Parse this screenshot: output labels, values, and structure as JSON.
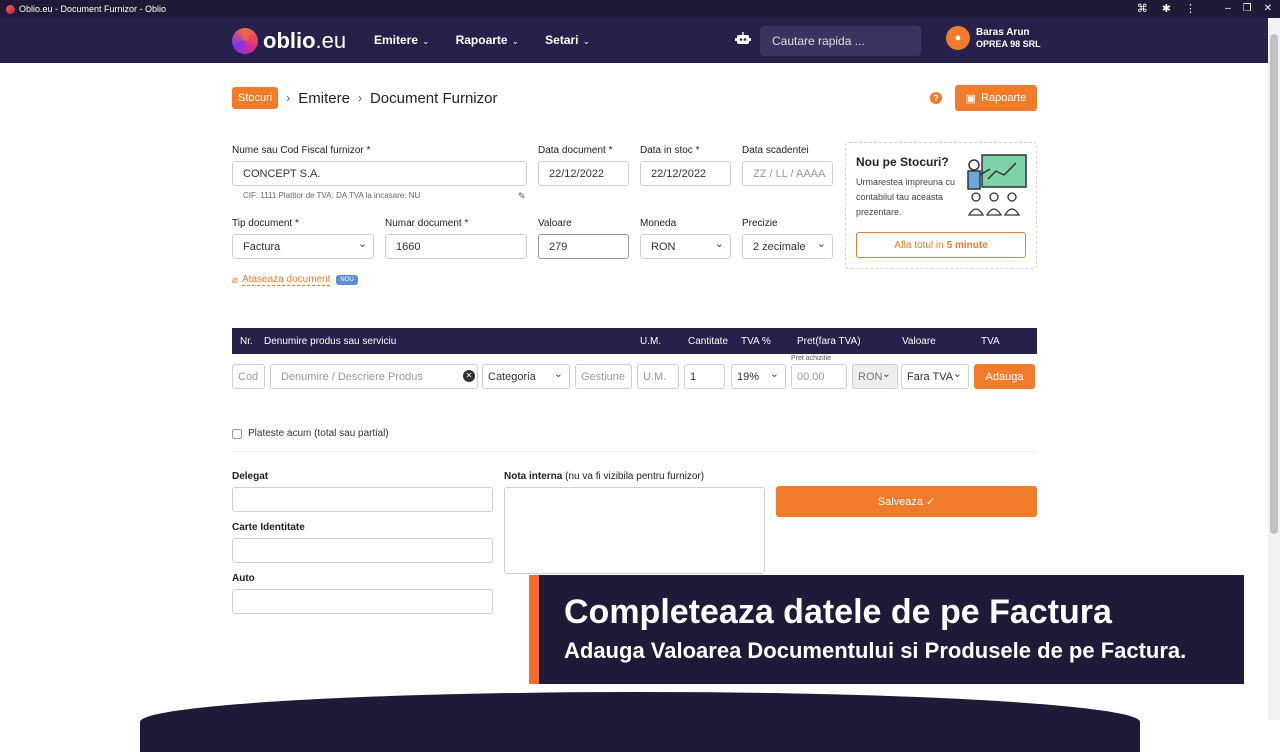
{
  "window": {
    "title": "Oblio.eu - Document Furnizor - Oblio"
  },
  "nav": {
    "logo_main": "oblio",
    "logo_tld": ".eu",
    "menu": [
      "Emitere",
      "Rapoarte",
      "Setari"
    ],
    "search_placeholder": "Cautare rapida ...",
    "user_name": "Baras Arun",
    "user_company": "OPREA 98 SRL"
  },
  "breadcrumb": {
    "badge": "Stocuri",
    "level2": "Emitere",
    "current": "Document Furnizor"
  },
  "header": {
    "reports_label": "Rapoarte",
    "help_symbol": "?"
  },
  "form": {
    "supplier_label": "Nume sau Cod Fiscal furnizor *",
    "supplier_value": "CONCEPT S.A.",
    "supplier_info": "CIF: 1111    Platitor de TVA: DA    TVA la incasare: NU",
    "doc_date_label": "Data document *",
    "doc_date_value": "22/12/2022",
    "stock_date_label": "Data in stoc *",
    "stock_date_value": "22/12/2022",
    "due_date_label": "Data scadentei",
    "due_date_placeholder": "ZZ / LL / AAAA",
    "doc_type_label": "Tip document *",
    "doc_type_value": "Factura",
    "doc_number_label": "Numar document *",
    "doc_number_value": "1660",
    "value_label": "Valoare",
    "value_value": "279",
    "currency_label": "Moneda",
    "currency_value": "RON",
    "precision_label": "Precizie",
    "precision_value": "2 zecimale",
    "attach_label": "Ataseaza document",
    "attach_badge": "NOU"
  },
  "promo": {
    "title": "Nou pe Stocuri?",
    "desc": "Urmarestea impreuna cu contabilul tau aceasta prezentare.",
    "cta_prefix": "Afla totul in",
    "cta_strong": "5 minute"
  },
  "table": {
    "headers": [
      "Nr.",
      "Denumire produs sau serviciu",
      "U.M.",
      "Cantitate",
      "TVA %",
      "Pret(fara TVA)",
      "Valoare",
      "TVA"
    ],
    "price_hint": "Pret achizitie",
    "code_placeholder": "Cod",
    "name_placeholder": "Denumire / Descriere Produs",
    "category_value": "Categoria",
    "gestiune_placeholder": "Gestiune",
    "um_placeholder": "U.M.",
    "qty_value": "1",
    "vat_value": "19%",
    "price_placeholder": "00.00",
    "row_currency": "RON",
    "vat_mode": "Fara TVA",
    "add_label": "Adauga"
  },
  "bottom": {
    "pay_now_label": "Plateste acum (total sau partial)",
    "delegate_label": "Delegat",
    "id_card_label": "Carte Identitate",
    "auto_label": "Auto",
    "note_label": "Nota interna",
    "note_hint": "(nu va fi vizibila pentru furnizor)",
    "save_label": "Salveaza ✓"
  },
  "overlay": {
    "line1": "Completeaza datele de pe Factura",
    "line2": "Adauga Valoarea Documentului si Produsele de pe Factura."
  },
  "colors": {
    "accent": "#f07b2a",
    "nav": "#26214a"
  }
}
